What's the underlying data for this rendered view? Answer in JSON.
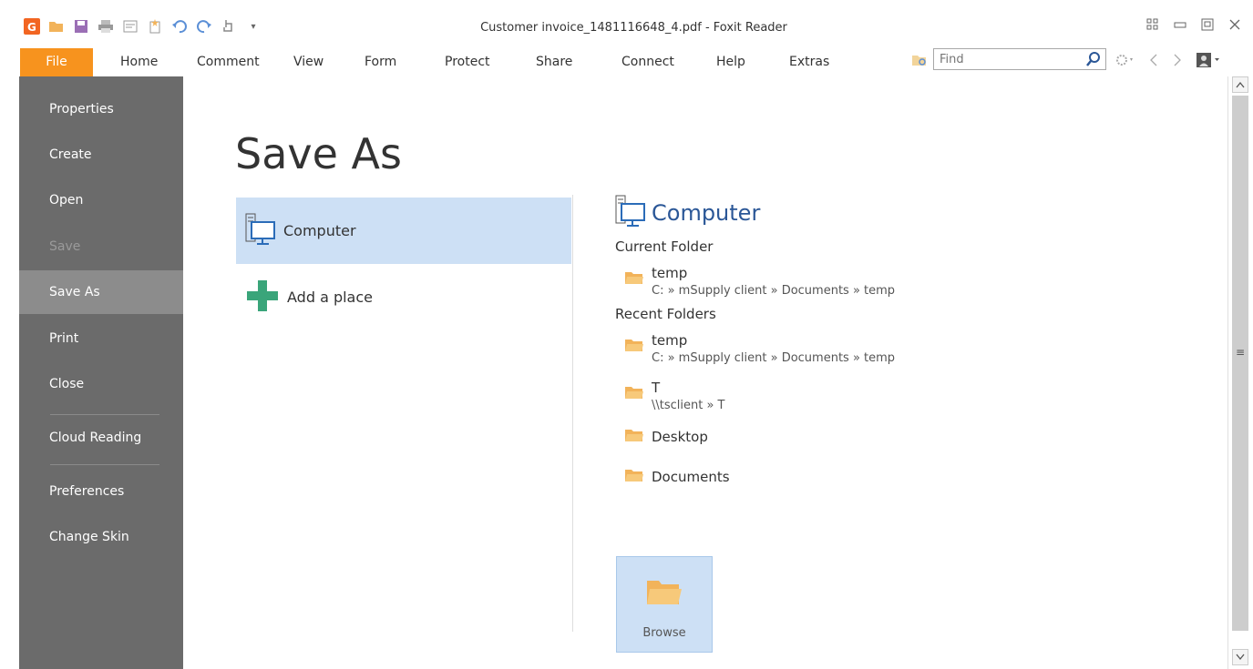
{
  "window": {
    "title": "Customer invoice_1481116648_4.pdf - Foxit Reader"
  },
  "ribbon": {
    "tabs": [
      "File",
      "Home",
      "Comment",
      "View",
      "Form",
      "Protect",
      "Share",
      "Connect",
      "Help",
      "Extras"
    ],
    "find_placeholder": "Find"
  },
  "nav": {
    "items": [
      "Properties",
      "Create",
      "Open",
      "Save",
      "Save As",
      "Print",
      "Close",
      "Cloud Reading",
      "Preferences",
      "Change Skin"
    ],
    "active": "Save As",
    "disabled": [
      "Save"
    ]
  },
  "main": {
    "title": "Save As",
    "places": [
      {
        "label": "Computer",
        "icon": "computer-icon"
      },
      {
        "label": "Add a place",
        "icon": "plus-icon"
      }
    ],
    "detail": {
      "heading": "Computer",
      "current_folder_label": "Current Folder",
      "current_folder": {
        "name": "temp",
        "path": "C: » mSupply client » Documents » temp"
      },
      "recent_folders_label": "Recent Folders",
      "recent_folders": [
        {
          "name": "temp",
          "path": "C: » mSupply client » Documents » temp"
        },
        {
          "name": "T",
          "path": "\\\\tsclient » T"
        },
        {
          "name": "Desktop",
          "path": ""
        },
        {
          "name": "Documents",
          "path": ""
        }
      ],
      "browse_label": "Browse"
    }
  },
  "colors": {
    "file_tab": "#f7931e",
    "nav_bg": "#6b6b6b",
    "nav_active": "#8c8c8c",
    "selected_place": "#cde0f5",
    "heading_blue": "#2b5797",
    "plus_green": "#3aa57a",
    "folder_orange": "#f2b35a"
  }
}
